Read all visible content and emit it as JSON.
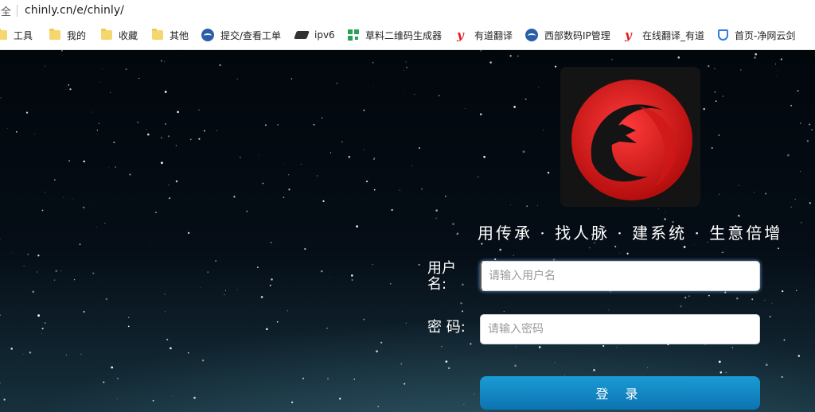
{
  "address_bar": {
    "security_text": "安全",
    "url": "chinly.cn/e/chinly/"
  },
  "bookmarks": [
    {
      "icon": "folder-icon",
      "label": "工具"
    },
    {
      "icon": "folder-icon",
      "label": "我的"
    },
    {
      "icon": "folder-icon",
      "label": "收藏"
    },
    {
      "icon": "folder-icon",
      "label": "其他"
    },
    {
      "icon": "wave-logo-icon",
      "label": "提交/查看工单"
    },
    {
      "icon": "cli-logo-icon",
      "label": "ipv6"
    },
    {
      "icon": "qr-code-icon",
      "label": "草料二维码生成器"
    },
    {
      "icon": "youdao-icon",
      "label": "有道翻译"
    },
    {
      "icon": "wave-logo-icon",
      "label": "西部数码IP管理"
    },
    {
      "icon": "youdao-icon",
      "label": "在线翻译_有道"
    },
    {
      "icon": "shield-icon",
      "label": "首页-净网云剑"
    }
  ],
  "login": {
    "logo": "red-dragon-logo",
    "slogan": "用传承 · 找人脉 · 建系统 · 生意倍增",
    "username_label": "用户名:",
    "username_placeholder": "请输入用户名",
    "password_label": "密 码:",
    "password_placeholder": "请输入密码",
    "submit_label": "登 录"
  },
  "colors": {
    "button": "#1b9bd4",
    "logo_red": "#e01b1b",
    "background": "#050d16"
  }
}
